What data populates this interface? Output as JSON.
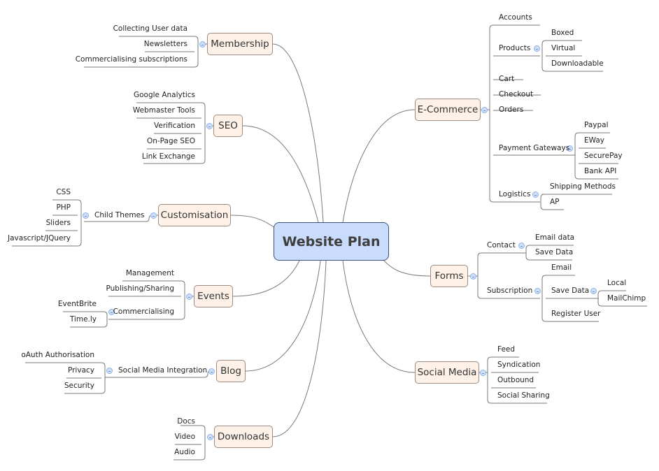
{
  "root": {
    "label": "Website Plan"
  },
  "branches": [
    {
      "label": "Membership",
      "children": [
        {
          "label": "Collecting User data"
        },
        {
          "label": "Newsletters"
        },
        {
          "label": "Commercialising subscriptions"
        }
      ]
    },
    {
      "label": "SEO",
      "children": [
        {
          "label": "Google Analytics"
        },
        {
          "label": "Webmaster Tools"
        },
        {
          "label": "Verification"
        },
        {
          "label": "On-Page SEO"
        },
        {
          "label": "Link Exchange"
        }
      ]
    },
    {
      "label": "Customisation",
      "children": [
        {
          "label": "Child Themes",
          "children": [
            {
              "label": "CSS"
            },
            {
              "label": "PHP"
            },
            {
              "label": "Sliders"
            },
            {
              "label": "Javascript/JQuery"
            }
          ]
        }
      ]
    },
    {
      "label": "Events",
      "children": [
        {
          "label": "Management"
        },
        {
          "label": "Publishing/Sharing"
        },
        {
          "label": "Commercialising",
          "children": [
            {
              "label": "EventBrite"
            },
            {
              "label": "Time.ly"
            }
          ]
        }
      ]
    },
    {
      "label": "Blog",
      "children": [
        {
          "label": "Social Media Integration",
          "children": [
            {
              "label": "oAuth Authorisation"
            },
            {
              "label": "Privacy"
            },
            {
              "label": "Security"
            }
          ]
        }
      ]
    },
    {
      "label": "Downloads",
      "children": [
        {
          "label": "Docs"
        },
        {
          "label": "Video"
        },
        {
          "label": "Audio"
        }
      ]
    },
    {
      "label": "E-Commerce",
      "children": [
        {
          "label": "Accounts"
        },
        {
          "label": "Products",
          "children": [
            {
              "label": "Boxed"
            },
            {
              "label": "Virtual"
            },
            {
              "label": "Downloadable"
            }
          ]
        },
        {
          "label": "Cart"
        },
        {
          "label": "Checkout"
        },
        {
          "label": "Orders"
        },
        {
          "label": "Payment Gateways",
          "children": [
            {
              "label": "Paypal"
            },
            {
              "label": "EWay"
            },
            {
              "label": "SecurePay"
            },
            {
              "label": "Bank API"
            }
          ]
        },
        {
          "label": "Logistics",
          "children": [
            {
              "label": "Shipping Methods"
            },
            {
              "label": "AP"
            }
          ]
        }
      ]
    },
    {
      "label": "Forms",
      "children": [
        {
          "label": "Contact",
          "children": [
            {
              "label": "Email data"
            },
            {
              "label": "Save Data"
            }
          ]
        },
        {
          "label": "Subscription",
          "children": [
            {
              "label": "Email"
            },
            {
              "label": "Save Data",
              "children": [
                {
                  "label": "Local"
                },
                {
                  "label": "MailChimp"
                }
              ]
            },
            {
              "label": "Register User"
            }
          ]
        }
      ]
    },
    {
      "label": "Social Media",
      "children": [
        {
          "label": "Feed"
        },
        {
          "label": "Syndication"
        },
        {
          "label": "Outbound"
        },
        {
          "label": "Social Sharing"
        }
      ]
    }
  ],
  "colors": {
    "root_fill": "#c9dcfb",
    "root_border": "#3b5378",
    "branch_fill": "#fdf1e8",
    "branch_border": "#9b8b80",
    "line": "#7a7a7a",
    "toggle": "#cfe0fb"
  }
}
